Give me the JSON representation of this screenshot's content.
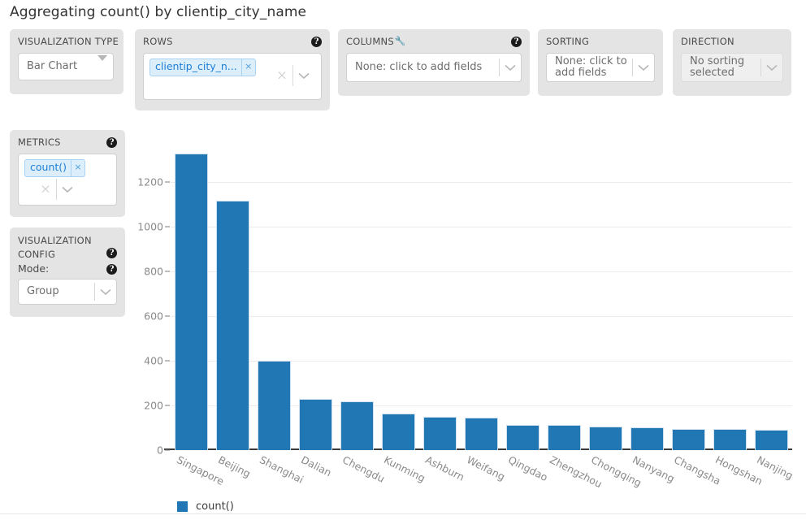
{
  "header": {
    "title": "Aggregating count() by clientip_city_name"
  },
  "controls": {
    "visualization_type": {
      "title": "VISUALIZATION TYPE",
      "value": "Bar Chart",
      "caret": "triangle-down-icon"
    },
    "rows": {
      "title": "ROWS",
      "help": "?",
      "chips": [
        {
          "label": "clientip_city_n...",
          "remove": "×"
        }
      ],
      "clear": "×",
      "caret": "chevron-down-icon"
    },
    "columns": {
      "title": "COLUMNS",
      "wrench": "🔧",
      "help": "?",
      "value": "None: click to add fields",
      "caret": "chevron-down-icon"
    },
    "sorting": {
      "title": "SORTING",
      "value": "None: click to add fields",
      "caret": "chevron-down-icon"
    },
    "direction": {
      "title": "DIRECTION",
      "value": "No sorting selected",
      "caret": "chevron-down-icon"
    },
    "metrics": {
      "title": "METRICS",
      "help": "?",
      "chips": [
        {
          "label": "count()",
          "remove": "×"
        }
      ],
      "clear": "×",
      "caret": "chevron-down-icon"
    },
    "visualization_config": {
      "title": "VISUALIZATION CONFIG",
      "help": "?",
      "mode_label": "Mode:",
      "mode_help": "?",
      "mode_value": "Group",
      "caret": "chevron-down-icon"
    }
  },
  "chart_data": {
    "type": "bar",
    "title": "Aggregating count() by clientip_city_name",
    "xlabel": "",
    "ylabel": "",
    "categories": [
      "Singapore",
      "Beijing",
      "Shanghai",
      "Dalian",
      "Chengdu",
      "Kunming",
      "Ashburn",
      "Weifang",
      "Qingdao",
      "Zhengzhou",
      "Chongqing",
      "Nanyang",
      "Changsha",
      "Hongshan",
      "Nanjing"
    ],
    "values": [
      1325,
      1115,
      400,
      230,
      218,
      162,
      150,
      145,
      113,
      112,
      105,
      100,
      96,
      95,
      92
    ],
    "series": [
      {
        "name": "count()",
        "color": "#2077b4",
        "values": [
          1325,
          1115,
          400,
          230,
          218,
          162,
          150,
          145,
          113,
          112,
          105,
          100,
          96,
          95,
          92
        ]
      }
    ],
    "yticks": [
      0,
      200,
      400,
      600,
      800,
      1000,
      1200
    ],
    "ylim": [
      0,
      1340
    ],
    "grid": true,
    "legend": {
      "position": "bottom-left",
      "entries": [
        "count()"
      ]
    }
  }
}
